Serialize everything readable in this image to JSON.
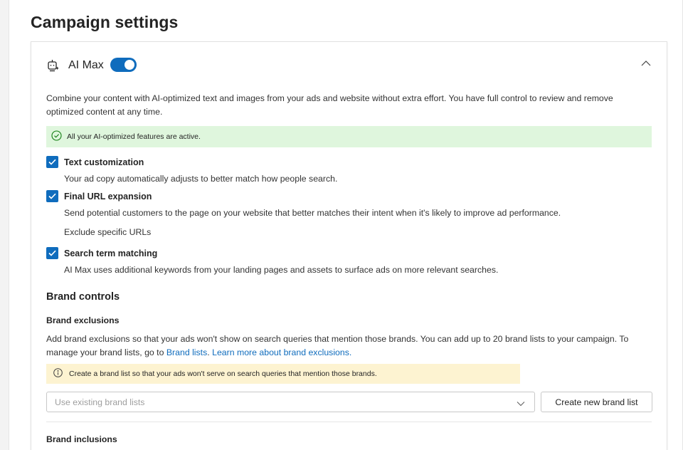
{
  "page": {
    "title": "Campaign settings"
  },
  "ai_max": {
    "title": "AI Max",
    "toggle_on": true,
    "description": "Combine your content with AI-optimized text and images from your ads and website without extra effort. You have full control to review and remove optimized content at any time.",
    "status_banner": "All your AI-optimized features are active.",
    "features": [
      {
        "label": "Text customization",
        "checked": true,
        "description": "Your ad copy automatically adjusts to better match how people search."
      },
      {
        "label": "Final URL expansion",
        "checked": true,
        "description": "Send potential customers to the page on your website that better matches their intent when it's likely to improve ad performance.",
        "extra_link": "Exclude specific URLs"
      },
      {
        "label": "Search term matching",
        "checked": true,
        "description": "AI Max uses additional keywords from your landing pages and assets to surface ads on more relevant searches."
      }
    ]
  },
  "brand_controls": {
    "title": "Brand controls",
    "exclusions": {
      "title": "Brand exclusions",
      "description_start": "Add brand exclusions so that your ads won't show on search queries that mention those brands. You can add up to 20 brand lists to your campaign. To manage your brand lists, go to ",
      "brand_lists_link": "Brand lists",
      "separator": ". ",
      "learn_more_link": "Learn more about brand exclusions.",
      "warning": "Create a brand list so that your ads won't serve on search queries that mention those brands.",
      "select_placeholder": "Use existing brand lists",
      "create_button": "Create new brand list"
    },
    "inclusions": {
      "title": "Brand inclusions"
    }
  },
  "colors": {
    "accent": "#0f6cbd",
    "success_bg": "#dff6dd",
    "warning_bg": "#fdf3d1"
  },
  "icons": [
    "ai-sparkle-icon",
    "chevron-up-icon",
    "check-circle-icon",
    "checkmark-icon",
    "info-icon",
    "chevron-down-icon"
  ]
}
